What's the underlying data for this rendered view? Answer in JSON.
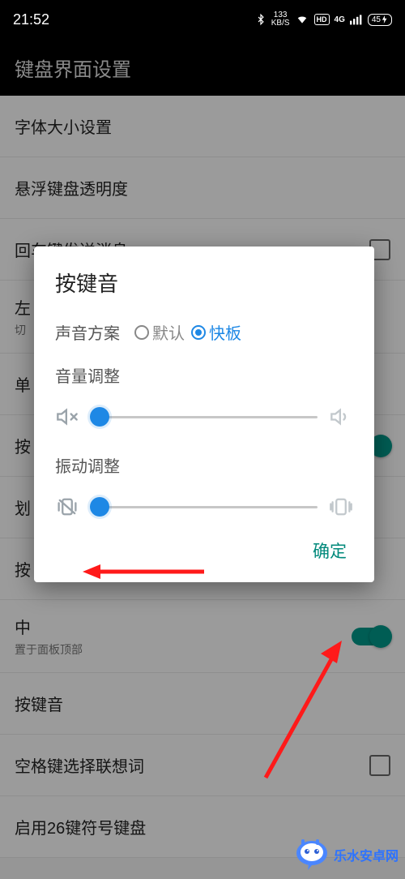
{
  "statusbar": {
    "time": "21:52",
    "net_speed": "133",
    "net_unit": "KB/S",
    "battery": "45"
  },
  "appbar": {
    "title": "键盘界面设置"
  },
  "rows": {
    "font": "字体大小设置",
    "float": "悬浮键盘透明度",
    "enter": "回车键发送消息",
    "left": "左",
    "left_sub": "切",
    "single": "单",
    "press": "按",
    "swipe": "划",
    "press2": "按",
    "center": "中",
    "center_sub": "置于面板顶部",
    "keysound": "按键音",
    "space": "空格键选择联想词",
    "enable26": "启用26键符号键盘"
  },
  "dialog": {
    "title": "按键音",
    "scheme_label": "声音方案",
    "radio_default": "默认",
    "radio_kuaiban": "快板",
    "volume_label": "音量调整",
    "vibrate_label": "振动调整",
    "ok": "确定",
    "slider1_pct": 4,
    "slider2_pct": 4
  },
  "watermark": {
    "text": "乐水安卓网"
  }
}
